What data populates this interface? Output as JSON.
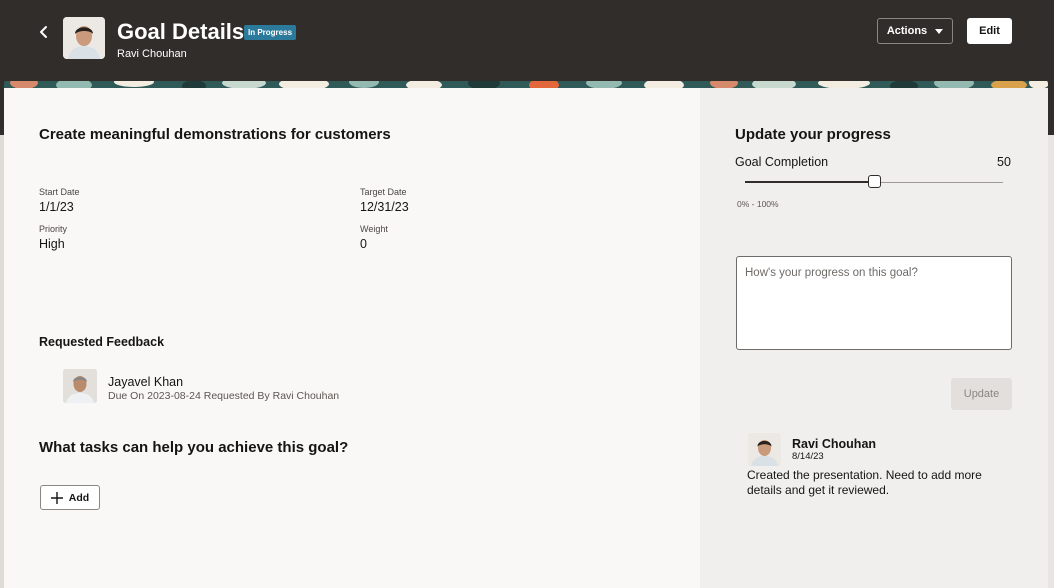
{
  "header": {
    "title": "Goal Details",
    "status_badge": "In Progress",
    "subtitle": "Ravi Chouhan",
    "actions_label": "Actions",
    "edit_label": "Edit",
    "back_icon": "chevron-left-icon",
    "colors": {
      "header_bg": "#312d2a",
      "badge_bg": "#2b7a9c"
    }
  },
  "goal": {
    "name": "Create meaningful demonstrations for customers",
    "fields": {
      "start_date_label": "Start Date",
      "start_date": "1/1/23",
      "target_date_label": "Target Date",
      "target_date": "12/31/23",
      "priority_label": "Priority",
      "priority": "High",
      "weight_label": "Weight",
      "weight": "0"
    }
  },
  "feedback": {
    "heading": "Requested Feedback",
    "items": [
      {
        "name": "Jayavel Khan",
        "meta": "Due On 2023-08-24 Requested By Ravi Chouhan"
      }
    ]
  },
  "tasks": {
    "heading": "What tasks can help you achieve this goal?",
    "add_label": "Add",
    "add_icon": "plus-icon"
  },
  "progress": {
    "heading": "Update your progress",
    "completion_label": "Goal Completion",
    "completion_value": "50",
    "slider_fraction": 0.5,
    "range_label": "0% - 100%",
    "comment_placeholder": "How's your progress on this goal?",
    "update_label": "Update"
  },
  "comment": {
    "author": "Ravi Chouhan",
    "date": "8/14/23",
    "text": "Created the presentation. Need to add more details and get it reviewed."
  }
}
